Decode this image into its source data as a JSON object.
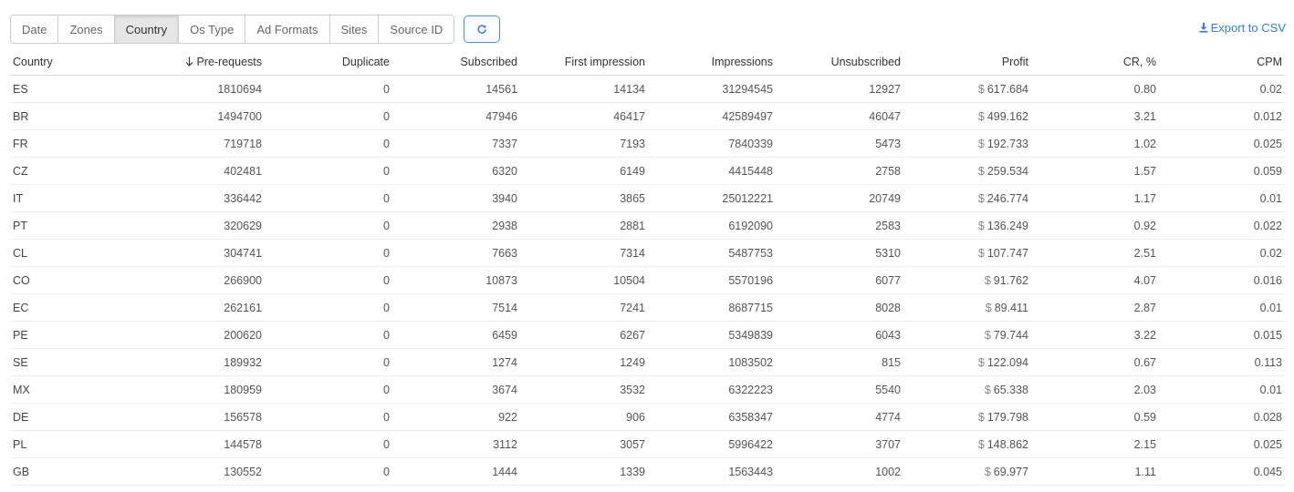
{
  "groupby": {
    "tabs": [
      {
        "label": "Date",
        "active": false
      },
      {
        "label": "Zones",
        "active": false
      },
      {
        "label": "Country",
        "active": true
      },
      {
        "label": "Os Type",
        "active": false
      },
      {
        "label": "Ad Formats",
        "active": false
      },
      {
        "label": "Sites",
        "active": false
      },
      {
        "label": "Source ID",
        "active": false
      }
    ],
    "refresh_icon": "refresh-icon"
  },
  "export": {
    "label": "Export to CSV",
    "icon": "download-icon"
  },
  "colors": {
    "accent": "#2f80d6",
    "active_tab_bg": "#e6e6e6"
  },
  "table": {
    "sorted_column": "Pre-requests",
    "sort_direction": "descending",
    "columns": [
      "Country",
      "Pre-requests",
      "Duplicate",
      "Subscribed",
      "First impression",
      "Impressions",
      "Unsubscribed",
      "Profit",
      "CR, %",
      "CPM"
    ],
    "currency_symbol": "$",
    "rows": [
      [
        "ES",
        "1810694",
        "0",
        "14561",
        "14134",
        "31294545",
        "12927",
        "617.684",
        "0.80",
        "0.02"
      ],
      [
        "BR",
        "1494700",
        "0",
        "47946",
        "46417",
        "42589497",
        "46047",
        "499.162",
        "3.21",
        "0.012"
      ],
      [
        "FR",
        "719718",
        "0",
        "7337",
        "7193",
        "7840339",
        "5473",
        "192.733",
        "1.02",
        "0.025"
      ],
      [
        "CZ",
        "402481",
        "0",
        "6320",
        "6149",
        "4415448",
        "2758",
        "259.534",
        "1.57",
        "0.059"
      ],
      [
        "IT",
        "336442",
        "0",
        "3940",
        "3865",
        "25012221",
        "20749",
        "246.774",
        "1.17",
        "0.01"
      ],
      [
        "PT",
        "320629",
        "0",
        "2938",
        "2881",
        "6192090",
        "2583",
        "136.249",
        "0.92",
        "0.022"
      ],
      [
        "CL",
        "304741",
        "0",
        "7663",
        "7314",
        "5487753",
        "5310",
        "107.747",
        "2.51",
        "0.02"
      ],
      [
        "CO",
        "266900",
        "0",
        "10873",
        "10504",
        "5570196",
        "6077",
        "91.762",
        "4.07",
        "0.016"
      ],
      [
        "EC",
        "262161",
        "0",
        "7514",
        "7241",
        "8687715",
        "8028",
        "89.411",
        "2.87",
        "0.01"
      ],
      [
        "PE",
        "200620",
        "0",
        "6459",
        "6267",
        "5349839",
        "6043",
        "79.744",
        "3.22",
        "0.015"
      ],
      [
        "SE",
        "189932",
        "0",
        "1274",
        "1249",
        "1083502",
        "815",
        "122.094",
        "0.67",
        "0.113"
      ],
      [
        "MX",
        "180959",
        "0",
        "3674",
        "3532",
        "6322223",
        "5540",
        "65.338",
        "2.03",
        "0.01"
      ],
      [
        "DE",
        "156578",
        "0",
        "922",
        "906",
        "6358347",
        "4774",
        "179.798",
        "0.59",
        "0.028"
      ],
      [
        "PL",
        "144578",
        "0",
        "3112",
        "3057",
        "5996422",
        "3707",
        "148.862",
        "2.15",
        "0.025"
      ],
      [
        "GB",
        "130552",
        "0",
        "1444",
        "1339",
        "1563443",
        "1002",
        "69.977",
        "1.11",
        "0.045"
      ]
    ]
  }
}
